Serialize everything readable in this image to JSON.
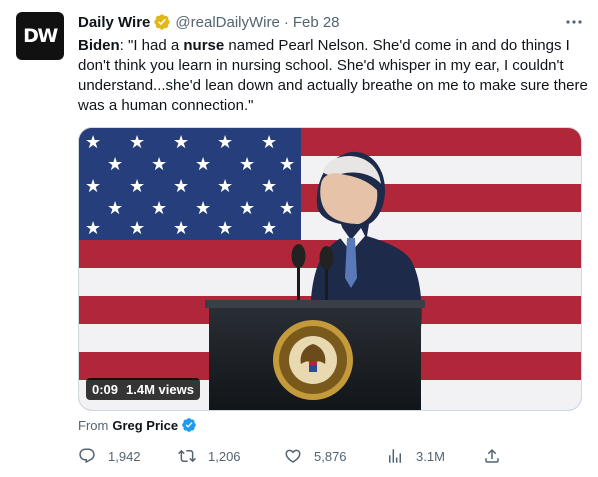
{
  "account": {
    "avatar_text": "DW",
    "display_name": "Daily Wire",
    "handle": "@realDailyWire",
    "date": "Feb 28"
  },
  "post": {
    "speaker": "Biden",
    "text_before": ": \"I had a ",
    "emphasis": "nurse",
    "text_after": " named Pearl Nelson. She'd come in and do things I don't think you learn in nursing school. She'd whisper in my ear, I couldn't understand...she'd lean down and actually breathe on me to make sure there was a human connection.\""
  },
  "media": {
    "duration": "0:09",
    "views": "1.4M views"
  },
  "attribution": {
    "label": "From",
    "author": "Greg Price"
  },
  "actions": {
    "replies": "1,942",
    "reposts": "1,206",
    "likes": "5,876",
    "views": "3.1M"
  },
  "colors": {
    "verified_gold": "#e2b719",
    "verified_blue": "#1d9bf0",
    "secondary_text": "#536471"
  }
}
